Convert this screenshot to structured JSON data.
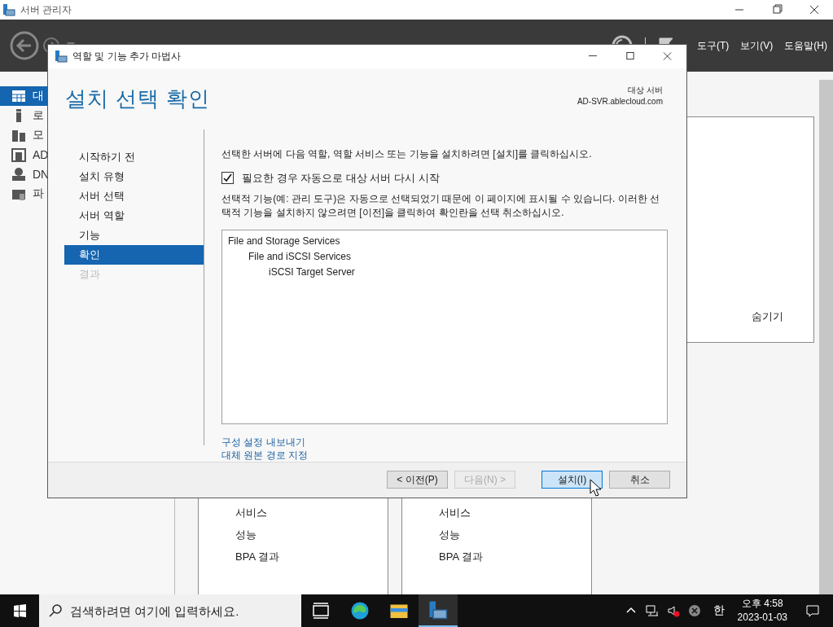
{
  "window": {
    "title": "서버 관리자"
  },
  "header": {
    "menus": [
      "도구(T)",
      "보기(V)",
      "도움말(H)"
    ]
  },
  "sidebar": {
    "items": [
      {
        "kind": "dashboard",
        "label": "대",
        "selected": true
      },
      {
        "kind": "local",
        "label": "로",
        "selected": false
      },
      {
        "kind": "all",
        "label": "모",
        "selected": false
      },
      {
        "kind": "ad",
        "label": "AD",
        "selected": false
      },
      {
        "kind": "dns",
        "label": "DN",
        "selected": false
      },
      {
        "kind": "file",
        "label": "파",
        "selected": false
      }
    ]
  },
  "welcome_panel": {
    "hide_link": "숨기기"
  },
  "tiles": [
    {
      "items": [
        "서비스",
        "성능",
        "BPA 결과"
      ]
    },
    {
      "items": [
        "서비스",
        "성능",
        "BPA 결과"
      ]
    }
  ],
  "dialog": {
    "title": "역할 및 기능 추가 마법사",
    "page_title": "설치 선택 확인",
    "target_label": "대상 서버",
    "target_server": "AD-SVR.ablecloud.com",
    "steps": [
      {
        "label": "시작하기 전",
        "selected": false,
        "disabled": false
      },
      {
        "label": "설치 유형",
        "selected": false,
        "disabled": false
      },
      {
        "label": "서버 선택",
        "selected": false,
        "disabled": false
      },
      {
        "label": "서버 역할",
        "selected": false,
        "disabled": false
      },
      {
        "label": "기능",
        "selected": false,
        "disabled": false
      },
      {
        "label": "확인",
        "selected": true,
        "disabled": false
      },
      {
        "label": "결과",
        "selected": false,
        "disabled": true
      }
    ],
    "intro": "선택한 서버에 다음 역할, 역할 서비스 또는 기능을 설치하려면 [설치]를 클릭하십시오.",
    "restart_checkbox": {
      "label": "필요한 경우 자동으로 대상 서버 다시 시작",
      "checked": true
    },
    "note": "선택적 기능(예: 관리 도구)은 자동으로 선택되었기 때문에 이 페이지에 표시될 수 있습니다. 이러한 선택적 기능을 설치하지 않으려면 [이전]을 클릭하여 확인란을 선택 취소하십시오.",
    "features": [
      {
        "label": "File and Storage Services",
        "children": [
          {
            "label": "File and iSCSI Services",
            "children": [
              {
                "label": "iSCSI Target Server"
              }
            ]
          }
        ]
      }
    ],
    "links": [
      "구성 설정 내보내기",
      "대체 원본 경로 지정"
    ],
    "buttons": [
      {
        "label": "< 이전(P)",
        "disabled": false,
        "selected": false
      },
      {
        "label": "다음(N) >",
        "disabled": true,
        "selected": false
      },
      {
        "label": "설치(I)",
        "disabled": false,
        "selected": true
      },
      {
        "label": "취소",
        "disabled": false,
        "selected": false
      }
    ]
  },
  "taskbar": {
    "search_placeholder": "검색하려면 여기에 입력하세요.",
    "apps": [
      {
        "kind": "taskview",
        "selected": false
      },
      {
        "kind": "edge",
        "selected": false
      },
      {
        "kind": "explorer",
        "selected": false
      },
      {
        "kind": "server",
        "selected": true
      }
    ],
    "ime": "한",
    "time": "오후 4:58",
    "date": "2023-01-03"
  }
}
